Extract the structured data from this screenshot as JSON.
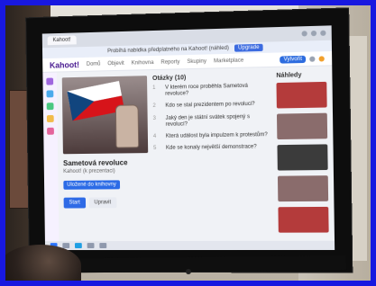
{
  "app": {
    "tab_title": "Kahoot!",
    "banner_text": "Probíhá nabídka předplatného na Kahoot! (náhled)",
    "banner_button": "Upgrade"
  },
  "nav": {
    "logo": "Kahoot!",
    "items": [
      "Domů",
      "Objevit",
      "Knihovna",
      "Reporty",
      "Skupiny",
      "Marketplace"
    ],
    "right_action": "Vytvořit"
  },
  "hero": {
    "title": "Sametová revoluce",
    "subtitle": "Kahoot! (k prezentaci)",
    "badge": "Uložené do knihovny",
    "primary_button": "Start",
    "secondary_button": "Upravit"
  },
  "questions": {
    "section_title": "Otázky (10)",
    "items": [
      {
        "num": "1",
        "text": "V kterém roce proběhla Sametová revoluce?"
      },
      {
        "num": "2",
        "text": "Kdo se stal prezidentem po revoluci?"
      },
      {
        "num": "3",
        "text": "Jaký den je státní svátek spojený s revolucí?"
      },
      {
        "num": "4",
        "text": "Která událost byla impulzem k protestům?"
      },
      {
        "num": "5",
        "text": "Kde se konaly největší demonstrace?"
      }
    ]
  },
  "right_panel": {
    "title": "Náhledy"
  },
  "colors": {
    "frame_blue": "#1818e0",
    "kahoot_purple": "#46178f",
    "accent_blue": "#2d6cdf"
  }
}
